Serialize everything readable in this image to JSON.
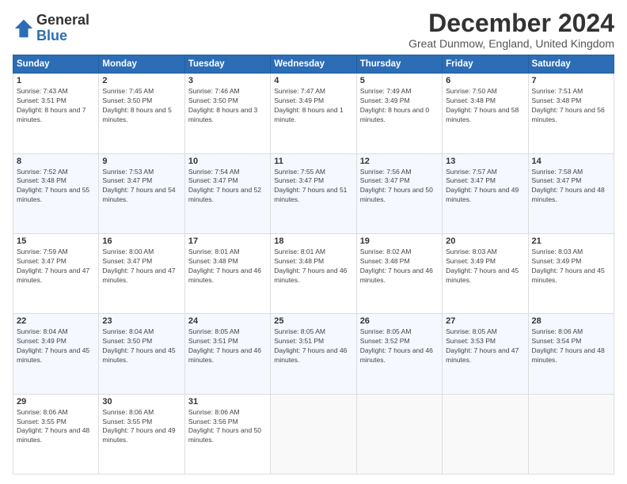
{
  "logo": {
    "line1": "General",
    "line2": "Blue"
  },
  "title": "December 2024",
  "subtitle": "Great Dunmow, England, United Kingdom",
  "headers": [
    "Sunday",
    "Monday",
    "Tuesday",
    "Wednesday",
    "Thursday",
    "Friday",
    "Saturday"
  ],
  "weeks": [
    [
      {
        "day": "1",
        "sunrise": "7:43 AM",
        "sunset": "3:51 PM",
        "daylight": "8 hours and 7 minutes."
      },
      {
        "day": "2",
        "sunrise": "7:45 AM",
        "sunset": "3:50 PM",
        "daylight": "8 hours and 5 minutes."
      },
      {
        "day": "3",
        "sunrise": "7:46 AM",
        "sunset": "3:50 PM",
        "daylight": "8 hours and 3 minutes."
      },
      {
        "day": "4",
        "sunrise": "7:47 AM",
        "sunset": "3:49 PM",
        "daylight": "8 hours and 1 minute."
      },
      {
        "day": "5",
        "sunrise": "7:49 AM",
        "sunset": "3:49 PM",
        "daylight": "8 hours and 0 minutes."
      },
      {
        "day": "6",
        "sunrise": "7:50 AM",
        "sunset": "3:48 PM",
        "daylight": "7 hours and 58 minutes."
      },
      {
        "day": "7",
        "sunrise": "7:51 AM",
        "sunset": "3:48 PM",
        "daylight": "7 hours and 56 minutes."
      }
    ],
    [
      {
        "day": "8",
        "sunrise": "7:52 AM",
        "sunset": "3:48 PM",
        "daylight": "7 hours and 55 minutes."
      },
      {
        "day": "9",
        "sunrise": "7:53 AM",
        "sunset": "3:47 PM",
        "daylight": "7 hours and 54 minutes."
      },
      {
        "day": "10",
        "sunrise": "7:54 AM",
        "sunset": "3:47 PM",
        "daylight": "7 hours and 52 minutes."
      },
      {
        "day": "11",
        "sunrise": "7:55 AM",
        "sunset": "3:47 PM",
        "daylight": "7 hours and 51 minutes."
      },
      {
        "day": "12",
        "sunrise": "7:56 AM",
        "sunset": "3:47 PM",
        "daylight": "7 hours and 50 minutes."
      },
      {
        "day": "13",
        "sunrise": "7:57 AM",
        "sunset": "3:47 PM",
        "daylight": "7 hours and 49 minutes."
      },
      {
        "day": "14",
        "sunrise": "7:58 AM",
        "sunset": "3:47 PM",
        "daylight": "7 hours and 48 minutes."
      }
    ],
    [
      {
        "day": "15",
        "sunrise": "7:59 AM",
        "sunset": "3:47 PM",
        "daylight": "7 hours and 47 minutes."
      },
      {
        "day": "16",
        "sunrise": "8:00 AM",
        "sunset": "3:47 PM",
        "daylight": "7 hours and 47 minutes."
      },
      {
        "day": "17",
        "sunrise": "8:01 AM",
        "sunset": "3:48 PM",
        "daylight": "7 hours and 46 minutes."
      },
      {
        "day": "18",
        "sunrise": "8:01 AM",
        "sunset": "3:48 PM",
        "daylight": "7 hours and 46 minutes."
      },
      {
        "day": "19",
        "sunrise": "8:02 AM",
        "sunset": "3:48 PM",
        "daylight": "7 hours and 46 minutes."
      },
      {
        "day": "20",
        "sunrise": "8:03 AM",
        "sunset": "3:49 PM",
        "daylight": "7 hours and 45 minutes."
      },
      {
        "day": "21",
        "sunrise": "8:03 AM",
        "sunset": "3:49 PM",
        "daylight": "7 hours and 45 minutes."
      }
    ],
    [
      {
        "day": "22",
        "sunrise": "8:04 AM",
        "sunset": "3:49 PM",
        "daylight": "7 hours and 45 minutes."
      },
      {
        "day": "23",
        "sunrise": "8:04 AM",
        "sunset": "3:50 PM",
        "daylight": "7 hours and 45 minutes."
      },
      {
        "day": "24",
        "sunrise": "8:05 AM",
        "sunset": "3:51 PM",
        "daylight": "7 hours and 46 minutes."
      },
      {
        "day": "25",
        "sunrise": "8:05 AM",
        "sunset": "3:51 PM",
        "daylight": "7 hours and 46 minutes."
      },
      {
        "day": "26",
        "sunrise": "8:05 AM",
        "sunset": "3:52 PM",
        "daylight": "7 hours and 46 minutes."
      },
      {
        "day": "27",
        "sunrise": "8:05 AM",
        "sunset": "3:53 PM",
        "daylight": "7 hours and 47 minutes."
      },
      {
        "day": "28",
        "sunrise": "8:06 AM",
        "sunset": "3:54 PM",
        "daylight": "7 hours and 48 minutes."
      }
    ],
    [
      {
        "day": "29",
        "sunrise": "8:06 AM",
        "sunset": "3:55 PM",
        "daylight": "7 hours and 48 minutes."
      },
      {
        "day": "30",
        "sunrise": "8:06 AM",
        "sunset": "3:55 PM",
        "daylight": "7 hours and 49 minutes."
      },
      {
        "day": "31",
        "sunrise": "8:06 AM",
        "sunset": "3:56 PM",
        "daylight": "7 hours and 50 minutes."
      },
      null,
      null,
      null,
      null
    ]
  ]
}
